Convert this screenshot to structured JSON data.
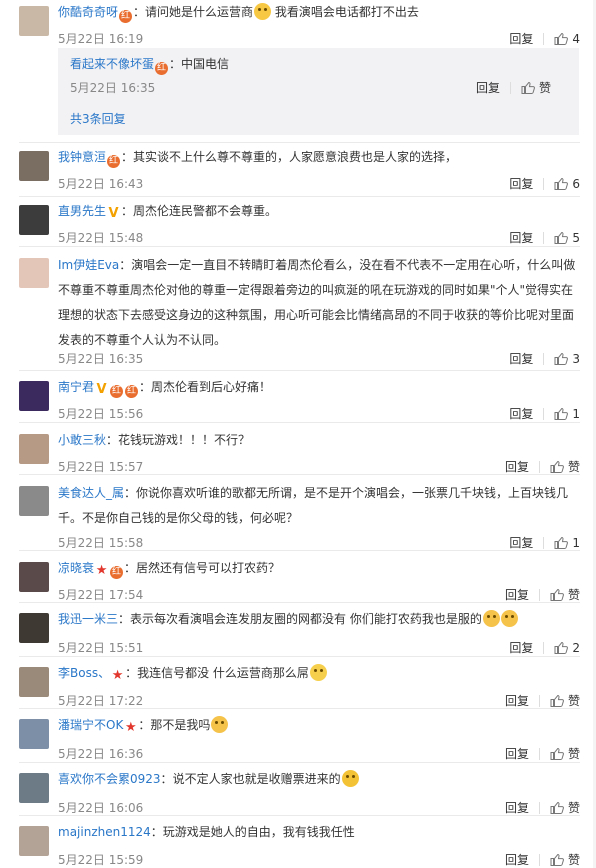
{
  "comments": [
    {
      "user": "你酷奇奇呀",
      "badges": [
        "red"
      ],
      "text": "请问她是什么运营商",
      "emoji_after": "smile",
      "text2": " 我看演唱会电话都打不出去",
      "time": "5月22日 16:19",
      "reply_label": "回复",
      "likes": "4",
      "avatar_color": "#c9b8a6",
      "sub": {
        "user": "看起来不像坏蛋",
        "text": "中国电信",
        "time": "5月22日 16:35",
        "reply_label": "回复",
        "like_label": "赞",
        "more": "共3条回复"
      }
    },
    {
      "user": "我钟意洹",
      "badges": [
        "red"
      ],
      "text": "其实谈不上什么尊不尊重的，人家愿意浪费也是人家的选择，",
      "time": "5月22日 16:43",
      "reply_label": "回复",
      "likes": "6",
      "avatar_color": "#7a6e63"
    },
    {
      "user": "直男先生",
      "badges": [
        "v"
      ],
      "text": "周杰伦连民警都不会尊重。",
      "time": "5月22日 15:48",
      "reply_label": "回复",
      "likes": "5",
      "avatar_color": "#3c3c3c"
    },
    {
      "user": "Im伊娃Eva",
      "badges": [],
      "text": "演唱会一定一直目不转睛盯着周杰伦看么，没在看不代表不一定用在心听，什么叫做不尊重不尊重周杰伦对他的尊重一定得跟着旁边的叫疯涎的吼在玩游戏的同时如果\"个人\"觉得实在理想的状态下去感受这身边的这种氛围，用心听可能会比情绪高昂的不同于收获的等价比呢对里面发表的不尊重个人认为不认同。",
      "time": "5月22日 16:35",
      "reply_label": "回复",
      "likes": "3",
      "avatar_color": "#e3c6b8"
    },
    {
      "user": "南宁君",
      "badges": [
        "v",
        "red",
        "red"
      ],
      "text": "周杰伦看到后心好痛！",
      "time": "5月22日 15:56",
      "reply_label": "回复",
      "likes": "1",
      "avatar_color": "#3b2a5e"
    },
    {
      "user": "小敢三秋",
      "badges": [],
      "text": "花钱玩游戏！！！不行？",
      "time": "5月22日 15:57",
      "reply_label": "回复",
      "likes": "赞",
      "avatar_color": "#b79a86"
    },
    {
      "user": "美食达人_属",
      "badges": [],
      "text": "你说你喜欢听谁的歌都无所谓，是不是开个演唱会，一张票几千块钱，上百块钱几千。不是你自己钱的是你父母的钱，何必呢？",
      "time": "5月22日 15:58",
      "reply_label": "回复",
      "likes": "1",
      "avatar_color": "#8a8a8a"
    },
    {
      "user": "凉晓衰",
      "badges": [
        "star",
        "red"
      ],
      "text": "居然还有信号可以打农药？",
      "time": "5月22日 17:54",
      "reply_label": "回复",
      "likes": "赞",
      "avatar_color": "#5b4a4a"
    },
    {
      "user": "我迅一米三",
      "badges": [],
      "text": "表示每次看演唱会连发朋友圈的网都没有 你们能打农药我也是服的",
      "emoji_after": "cat2",
      "time": "5月22日 15:51",
      "reply_label": "回复",
      "likes": "2",
      "avatar_color": "#3e3a33"
    },
    {
      "user": "李Boss、",
      "badges": [
        "star"
      ],
      "text": "我连信号都没 什么运营商那么屌",
      "emoji_after": "sweat",
      "time": "5月22日 17:22",
      "reply_label": "回复",
      "likes": "赞",
      "avatar_color": "#9a8a7a"
    },
    {
      "user": "潘瑞宁不OK",
      "badges": [
        "star"
      ],
      "text": "那不是我吗",
      "emoji_after": "cat",
      "time": "5月22日 16:36",
      "reply_label": "回复",
      "likes": "赞",
      "avatar_color": "#7c8fa6"
    },
    {
      "user": "喜欢你不会累0923",
      "badges": [],
      "text": "说不定人家也就是收赠票进来的",
      "emoji_after": "think",
      "time": "5月22日 16:06",
      "reply_label": "回复",
      "likes": "赞",
      "avatar_color": "#6d7b86"
    },
    {
      "user": "majinzhen1124",
      "badges": [],
      "text": "玩游戏是她人的自由，我有钱我任性",
      "time": "5月22日 15:59",
      "reply_label": "回复",
      "likes": "赞",
      "avatar_color": "#b3a296"
    }
  ],
  "colors": {
    "link": "#2a77c8",
    "meta": "#888888",
    "red_badge": "#e96d2e",
    "v_badge": "#f2a100",
    "star": "#e2372d"
  },
  "icons": {
    "like": "thumb-up-icon",
    "reply": "reply-link"
  }
}
